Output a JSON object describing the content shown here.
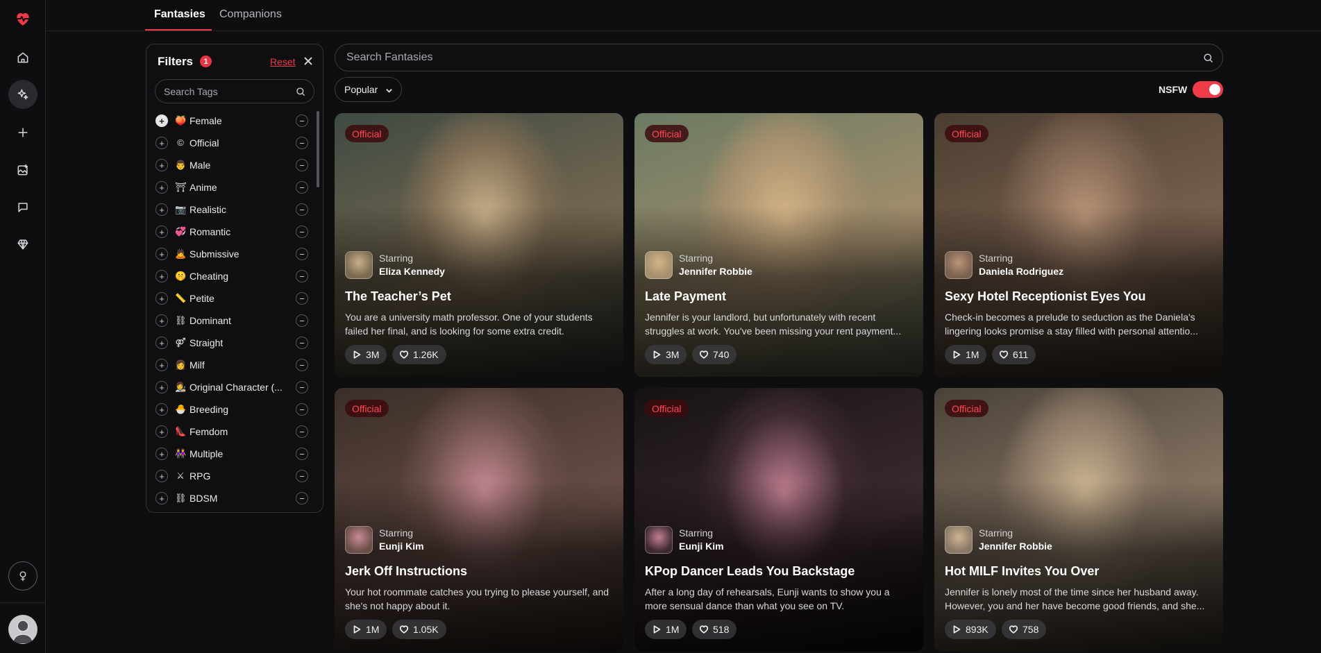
{
  "rail": {
    "items": [
      {
        "name": "heart-logo-icon"
      },
      {
        "name": "home-icon"
      },
      {
        "name": "sparkle-icon"
      },
      {
        "name": "plus-icon"
      },
      {
        "name": "image-add-icon"
      },
      {
        "name": "chat-icon"
      },
      {
        "name": "diamond-icon"
      }
    ],
    "bottom": {
      "name": "gender-icon"
    },
    "accent": "#ef3b47"
  },
  "tabs": [
    {
      "label": "Fantasies",
      "active": true
    },
    {
      "label": "Companions",
      "active": false
    }
  ],
  "filters": {
    "title": "Filters",
    "count": "1",
    "reset_label": "Reset",
    "search_placeholder": "Search Tags",
    "tags": [
      {
        "emoji": "🍑",
        "label": "Female",
        "included": true
      },
      {
        "emoji": "©",
        "label": "Official",
        "included": false
      },
      {
        "emoji": "👨",
        "label": "Male",
        "included": false
      },
      {
        "emoji": "⛩",
        "label": "Anime",
        "included": false
      },
      {
        "emoji": "📷",
        "label": "Realistic",
        "included": false
      },
      {
        "emoji": "💞",
        "label": "Romantic",
        "included": false
      },
      {
        "emoji": "🙇",
        "label": "Submissive",
        "included": false
      },
      {
        "emoji": "🤫",
        "label": "Cheating",
        "included": false
      },
      {
        "emoji": "📏",
        "label": "Petite",
        "included": false
      },
      {
        "emoji": "⛓",
        "label": "Dominant",
        "included": false
      },
      {
        "emoji": "⚤",
        "label": "Straight",
        "included": false
      },
      {
        "emoji": "👩",
        "label": "Milf",
        "included": false
      },
      {
        "emoji": "👩‍🎨",
        "label": "Original Character (...",
        "included": false
      },
      {
        "emoji": "🐣",
        "label": "Breeding",
        "included": false
      },
      {
        "emoji": "👠",
        "label": "Femdom",
        "included": false
      },
      {
        "emoji": "👭",
        "label": "Multiple",
        "included": false
      },
      {
        "emoji": "⚔",
        "label": "RPG",
        "included": false
      },
      {
        "emoji": "⛓",
        "label": "BDSM",
        "included": false
      }
    ]
  },
  "search": {
    "placeholder": "Search Fantasies"
  },
  "sort": {
    "label": "Popular"
  },
  "nsfw": {
    "label": "NSFW",
    "on": true
  },
  "official_label": "Official",
  "starring_label": "Starring",
  "cards": [
    {
      "star": "Eliza Kennedy",
      "title": "The Teacher’s Pet",
      "desc": "You are a university math professor. One of your students failed her final, and is looking for some extra credit.",
      "plays": "3M",
      "likes": "1.26K",
      "palette": [
        "#3e4a42",
        "#7a6a52",
        "#c9b08a"
      ]
    },
    {
      "star": "Jennifer Robbie",
      "title": "Late Payment",
      "desc": "Jennifer is your landlord, but unfortunately with recent struggles at work. You've been missing your rent payment...",
      "plays": "3M",
      "likes": "740",
      "palette": [
        "#6b7a62",
        "#a58f6e",
        "#d3b487"
      ]
    },
    {
      "star": "Daniela Rodriguez",
      "title": "Sexy Hotel Receptionist Eyes You",
      "desc": "Check-in becomes a prelude to seduction as the Daniela's lingering looks promise a stay filled with personal attentio...",
      "plays": "1M",
      "likes": "611",
      "palette": [
        "#4a3e30",
        "#7b6250",
        "#b99579"
      ]
    },
    {
      "star": "Eunji Kim",
      "title": "Jerk Off Instructions",
      "desc": "Your hot roommate catches you trying to please yourself, and she's not happy about it.",
      "plays": "1M",
      "likes": "1.05K",
      "palette": [
        "#3a2e28",
        "#6a4f48",
        "#c88a96"
      ]
    },
    {
      "star": "Eunji Kim",
      "title": "KPop Dancer Leads You Backstage",
      "desc": "After a long day of rehearsals, Eunji wants to show you a more sensual dance than what you see on TV.",
      "plays": "1M",
      "likes": "518",
      "palette": [
        "#151214",
        "#3d2a30",
        "#c27f92"
      ]
    },
    {
      "star": "Jennifer Robbie",
      "title": "Hot MILF Invites You Over",
      "desc": "Jennifer is lonely most of the time since her husband away. However, you and her have become good friends, and she...",
      "plays": "893K",
      "likes": "758",
      "palette": [
        "#4a4238",
        "#8a7866",
        "#cdb593"
      ]
    }
  ]
}
